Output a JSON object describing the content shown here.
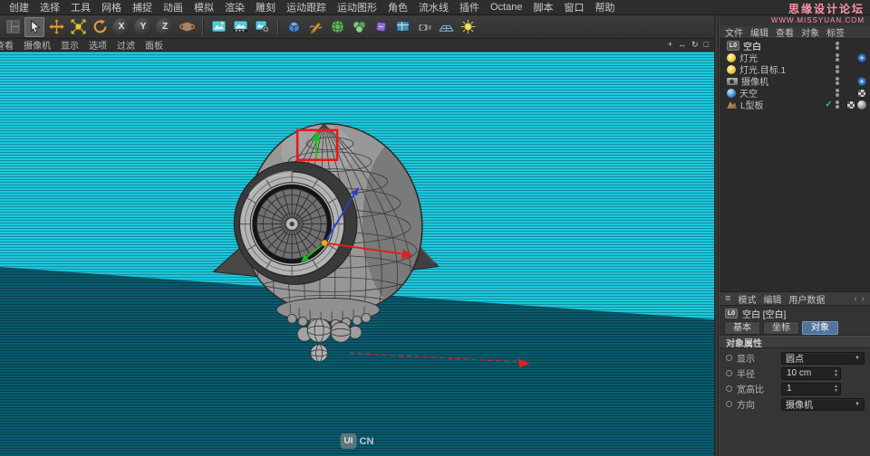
{
  "menu_bar": {
    "items": [
      "创建",
      "选择",
      "工具",
      "网格",
      "捕捉",
      "动画",
      "模拟",
      "渲染",
      "雕刻",
      "运动跟踪",
      "运动图形",
      "角色",
      "流水线",
      "插件",
      "Octane",
      "脚本",
      "窗口",
      "帮助"
    ]
  },
  "site_watermark": {
    "line1": "思缘设计论坛",
    "line2": "WWW.MISSYUAN.COM"
  },
  "toolbar": {
    "axis_x": "X",
    "axis_y": "Y",
    "axis_z": "Z",
    "icons": [
      "layout-icon",
      "select-tool-icon",
      "move-tool-icon",
      "scale-tool-icon",
      "rotate-tool-icon",
      "x-axis-toggle",
      "y-axis-toggle",
      "z-axis-toggle",
      "coordinate-system-icon",
      "render-view-icon",
      "render-picture-viewer-icon",
      "render-settings-icon",
      "cube-primitive-icon",
      "spline-pen-icon",
      "subdivision-surface-icon",
      "modeling-objects-icon",
      "deformer-icon",
      "scene-window-icon",
      "camera-icon",
      "environment-icon",
      "light-icon"
    ]
  },
  "viewport": {
    "menu": [
      "查看",
      "摄像机",
      "显示",
      "选项",
      "过滤",
      "面板"
    ],
    "nav_icons": [
      {
        "name": "pan-view-icon",
        "glyph": "+"
      },
      {
        "name": "zoom-view-icon",
        "glyph": "↔"
      },
      {
        "name": "rotate-view-icon",
        "glyph": "↻"
      },
      {
        "name": "toggle-view-icon",
        "glyph": "□"
      }
    ],
    "watermark": {
      "badge": "UI",
      "suffix": "CN"
    }
  },
  "object_manager": {
    "menus": [
      "文件",
      "编辑",
      "查看",
      "对象",
      "标签"
    ],
    "objects": [
      {
        "name": "空白",
        "icon": "null-object-icon",
        "icon_label": "L0",
        "selected": true,
        "tags": []
      },
      {
        "name": "灯光",
        "icon": "light-object-icon",
        "tags": [
          "target-tag"
        ]
      },
      {
        "name": "灯光.目标.1",
        "icon": "light-object-icon",
        "tags": []
      },
      {
        "name": "摄像机",
        "icon": "camera-object-icon",
        "tags": [
          "target-tag"
        ]
      },
      {
        "name": "天空",
        "icon": "sky-object-icon",
        "tags": [
          "texture-tag"
        ]
      },
      {
        "name": "L型板",
        "icon": "terrain-object-icon",
        "tags": [
          "texture-tag",
          "phong-tag"
        ],
        "enabled_check": true
      }
    ]
  },
  "attribute_manager": {
    "tabs": [
      "模式",
      "编辑",
      "用户数据"
    ],
    "object_icon_label": "L0",
    "object_title": "空白 [空白]",
    "sub_tabs": [
      "基本",
      "坐标",
      "对象"
    ],
    "active_sub_tab": "对象",
    "section_title": "对象属性",
    "properties": [
      {
        "label": "显示",
        "value": "圆点",
        "control": "dropdown"
      },
      {
        "label": "半径",
        "value": "10 cm",
        "control": "number"
      },
      {
        "label": "宽高比",
        "value": "1",
        "control": "number"
      },
      {
        "label": "方向",
        "value": "摄像机",
        "control": "dropdown"
      }
    ]
  },
  "glyphs": {
    "dropdown_arrow": "▼",
    "stepper_up": "▲",
    "stepper_down": "▼",
    "check": "✓",
    "burger": "≡",
    "chevron_left": "‹",
    "chevron_right": "›"
  },
  "colors": {
    "sky": "#1ec7db",
    "floor": "#0a5c6e",
    "selection": "#f21313",
    "axis_red": "#e02020",
    "axis_green": "#1fba1f",
    "axis_blue": "#2b3fd6",
    "accent_tab": "#51749c"
  }
}
